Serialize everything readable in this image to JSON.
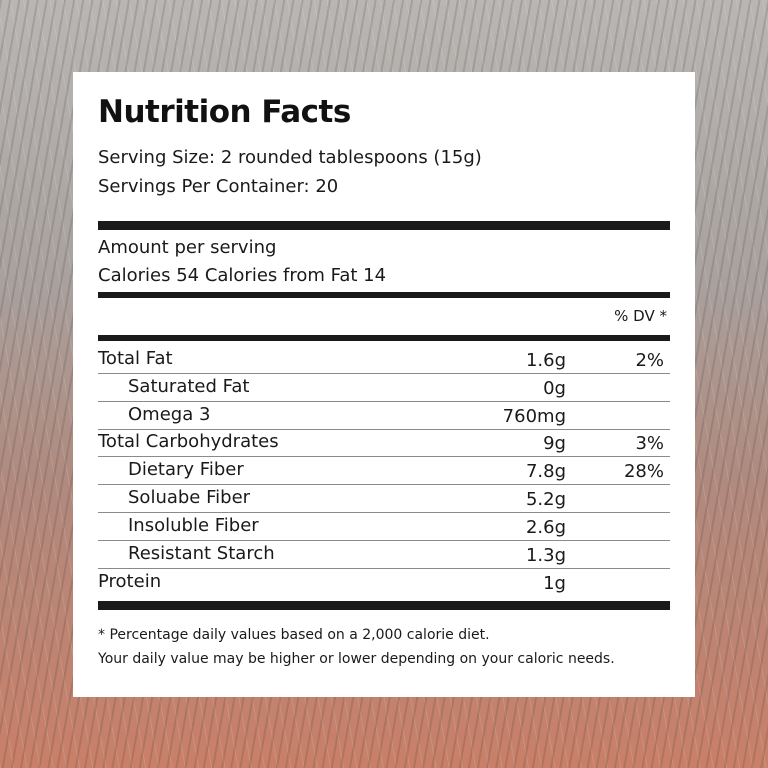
{
  "label": {
    "title": "Nutrition Facts",
    "serving_size": "Serving Size: 2 rounded tablespoons (15g)",
    "servings_per_container": "Servings Per Container:  20",
    "amount_per_serving": "Amount per serving",
    "calories_line": "Calories 54  Calories from Fat 14",
    "dv_header": "% DV *",
    "rows": [
      {
        "name": "Total Fat",
        "amount": "1.6g",
        "dv": "2%"
      },
      {
        "name": "Saturated Fat",
        "amount": "0g",
        "dv": ""
      },
      {
        "name": "Omega 3",
        "amount": "760mg",
        "dv": ""
      },
      {
        "name": "Total Carbohydrates",
        "amount": "9g",
        "dv": "3%"
      },
      {
        "name": "Dietary Fiber",
        "amount": "7.8g",
        "dv": "28%"
      },
      {
        "name": "Soluabe Fiber",
        "amount": "5.2g",
        "dv": ""
      },
      {
        "name": "Insoluble Fiber",
        "amount": "2.6g",
        "dv": ""
      },
      {
        "name": "Resistant Starch",
        "amount": "1.3g",
        "dv": ""
      },
      {
        "name": "Protein",
        "amount": "1g",
        "dv": ""
      }
    ],
    "footnote_1": "* Percentage daily values based on a 2,000 calorie diet.",
    "footnote_2": "Your daily value may be higher or lower depending on your caloric needs."
  }
}
